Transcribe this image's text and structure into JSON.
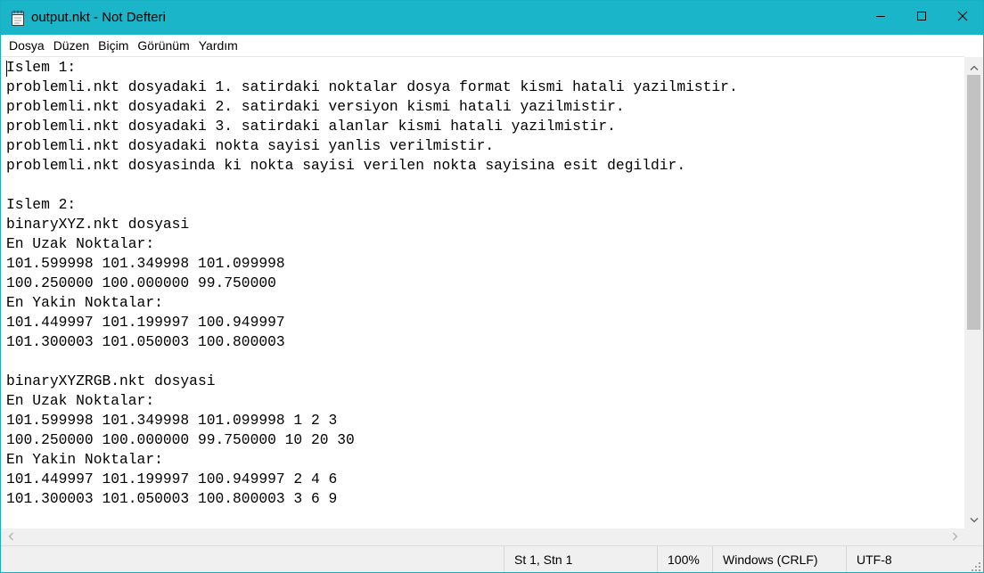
{
  "window": {
    "title": "output.nkt - Not Defteri",
    "app_icon": "notepad-icon",
    "controls": {
      "minimize_icon": "minimize-icon",
      "maximize_icon": "maximize-icon",
      "close_icon": "close-icon"
    }
  },
  "menu": {
    "items": [
      {
        "label": "Dosya"
      },
      {
        "label": "Düzen"
      },
      {
        "label": "Biçim"
      },
      {
        "label": "Görünüm"
      },
      {
        "label": "Yardım"
      }
    ]
  },
  "editor": {
    "lines": [
      "Islem 1:",
      "problemli.nkt dosyadaki 1. satirdaki noktalar dosya format kismi hatali yazilmistir.",
      "problemli.nkt dosyadaki 2. satirdaki versiyon kismi hatali yazilmistir.",
      "problemli.nkt dosyadaki 3. satirdaki alanlar kismi hatali yazilmistir.",
      "problemli.nkt dosyadaki nokta sayisi yanlis verilmistir.",
      "problemli.nkt dosyasinda ki nokta sayisi verilen nokta sayisina esit degildir.",
      "",
      "Islem 2:",
      "binaryXYZ.nkt dosyasi",
      "En Uzak Noktalar:",
      "101.599998 101.349998 101.099998",
      "100.250000 100.000000 99.750000",
      "En Yakin Noktalar:",
      "101.449997 101.199997 100.949997",
      "101.300003 101.050003 100.800003",
      "",
      "binaryXYZRGB.nkt dosyasi",
      "En Uzak Noktalar:",
      "101.599998 101.349998 101.099998 1 2 3",
      "100.250000 100.000000 99.750000 10 20 30",
      "En Yakin Noktalar:",
      "101.449997 101.199997 100.949997 2 4 6",
      "101.300003 101.050003 100.800003 3 6 9"
    ]
  },
  "statusbar": {
    "position": "St 1, Stn 1",
    "zoom": "100%",
    "line_ending": "Windows (CRLF)",
    "encoding": "UTF-8"
  },
  "colors": {
    "titlebar": "#1ab5c8",
    "chrome": "#f0f0f0",
    "scroll_thumb": "#c2c2c2"
  }
}
